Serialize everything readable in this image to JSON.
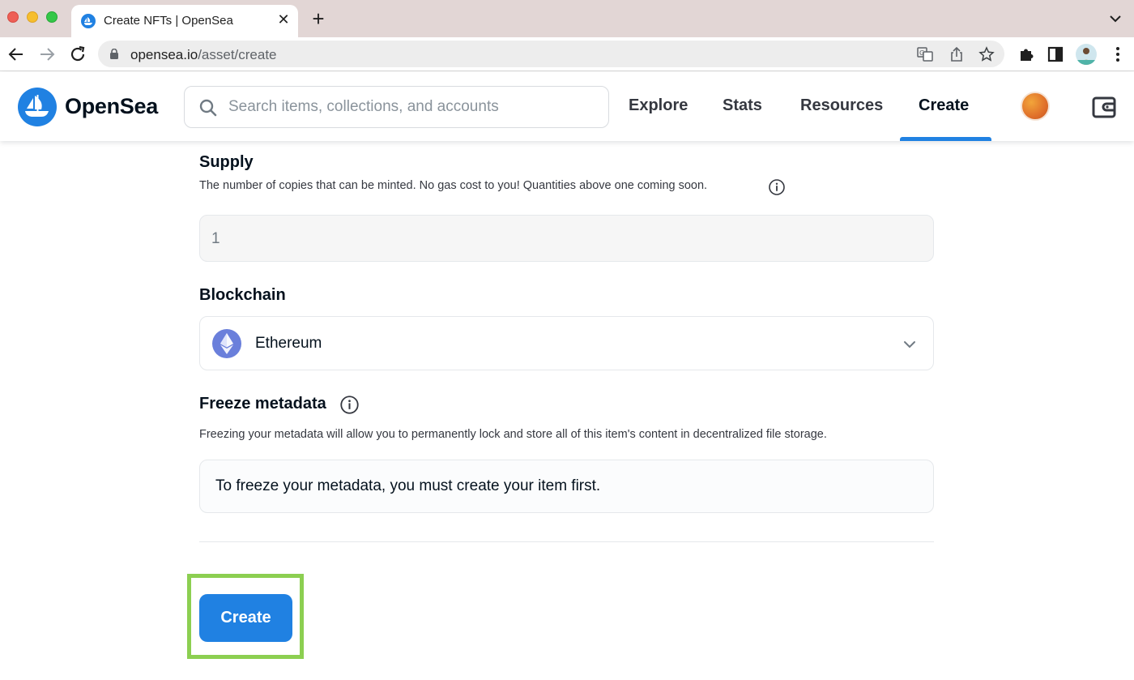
{
  "browser": {
    "tab_title": "Create NFTs | OpenSea",
    "tab_close": "✕",
    "new_tab": "+",
    "url_host": "opensea.io",
    "url_path": "/asset/create"
  },
  "header": {
    "brand": "OpenSea",
    "search_placeholder": "Search items, collections, and accounts",
    "nav": [
      {
        "label": "Explore"
      },
      {
        "label": "Stats"
      },
      {
        "label": "Resources"
      },
      {
        "label": "Create",
        "active": true
      }
    ]
  },
  "form": {
    "supply": {
      "label": "Supply",
      "description": "The number of copies that can be minted. No gas cost to you! Quantities above one coming soon.",
      "value": "1"
    },
    "blockchain": {
      "label": "Blockchain",
      "selected": "Ethereum"
    },
    "freeze": {
      "label": "Freeze metadata",
      "description": "Freezing your metadata will allow you to permanently lock and store all of this item's content in decentralized file storage.",
      "notice": "To freeze your metadata, you must create your item first."
    },
    "submit_label": "Create"
  },
  "colors": {
    "brand_blue": "#2081e2",
    "highlight_green": "#8ccf51",
    "ethereum": "#6a7fdb"
  },
  "icons": [
    "search-icon",
    "info-icon",
    "chevron-down-icon",
    "wallet-icon",
    "ethereum-icon",
    "lock-icon"
  ]
}
